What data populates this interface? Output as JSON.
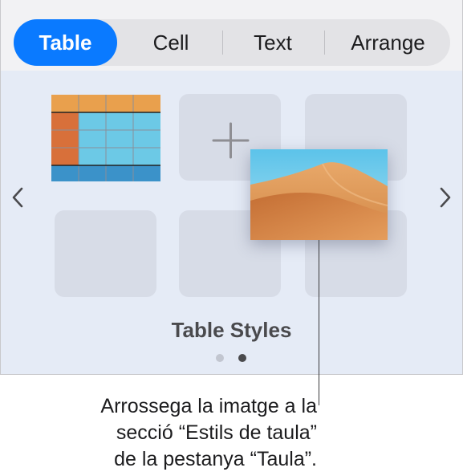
{
  "tabs": [
    {
      "label": "Table",
      "active": true
    },
    {
      "label": "Cell",
      "active": false
    },
    {
      "label": "Text",
      "active": false
    },
    {
      "label": "Arrange",
      "active": false
    }
  ],
  "colors": {
    "accent": "#0a7aff",
    "panel_bg": "#e5ebf6",
    "tile_bg": "#d7dce7",
    "table_header_orange": "#e9a04d",
    "table_side_orange": "#d8703a",
    "table_body_cyan": "#6cc9e6",
    "table_footer_blue": "#3b92c9"
  },
  "icons": {
    "prev": "chevron-left-icon",
    "next": "chevron-right-icon",
    "add": "plus-icon"
  },
  "table_styles": {
    "title": "Table Styles",
    "page_count": 2,
    "current_page": 2
  },
  "caption": {
    "lines": [
      "Arrossega la imatge a la",
      "secció “Estils de taula”",
      "de la pestanya “Taula”."
    ]
  }
}
